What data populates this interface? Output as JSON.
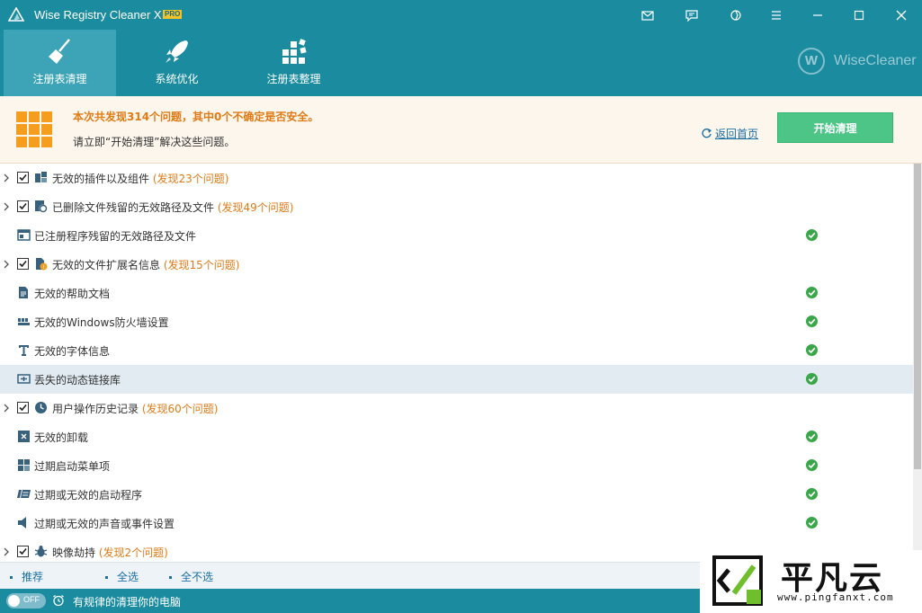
{
  "app": {
    "title": "Wise Registry Cleaner X",
    "badge": "PRO"
  },
  "window_controls": [
    {
      "name": "mail-icon"
    },
    {
      "name": "feedback-icon"
    },
    {
      "name": "skin-icon"
    },
    {
      "name": "menu-icon"
    },
    {
      "name": "minimize-icon"
    },
    {
      "name": "maximize-icon"
    },
    {
      "name": "close-icon"
    }
  ],
  "tabs": [
    {
      "label": "注册表清理",
      "icon": "broom-icon",
      "active": true
    },
    {
      "label": "系统优化",
      "icon": "rocket-icon",
      "active": false
    },
    {
      "label": "注册表整理",
      "icon": "blocks-icon",
      "active": false
    }
  ],
  "brand": {
    "letter": "W",
    "text": "WiseCleaner"
  },
  "banner": {
    "headline": "本次共发现314个问题，其中0个不确定是否安全。",
    "sub": "请立即“开始清理”解决这些问题。",
    "back_link": "返回首页",
    "start_button": "开始清理"
  },
  "items": [
    {
      "label": "无效的插件以及组件",
      "count": "(发现23个问题)",
      "expandable": true,
      "checked": true,
      "ok": false,
      "icon": "plugin-icon",
      "highlighted": false
    },
    {
      "label": "已删除文件残留的无效路径及文件",
      "count": "(发现49个问题)",
      "expandable": true,
      "checked": true,
      "ok": false,
      "icon": "deleted-file-icon",
      "highlighted": false
    },
    {
      "label": "已注册程序残留的无效路径及文件",
      "count": "",
      "expandable": false,
      "checked": false,
      "ok": true,
      "icon": "program-window-icon",
      "highlighted": false
    },
    {
      "label": "无效的文件扩展名信息",
      "count": "(发现15个问题)",
      "expandable": true,
      "checked": true,
      "ok": false,
      "icon": "file-extension-icon",
      "highlighted": false
    },
    {
      "label": "无效的帮助文档",
      "count": "",
      "expandable": false,
      "checked": false,
      "ok": true,
      "icon": "help-document-icon",
      "highlighted": false
    },
    {
      "label": "无效的Windows防火墙设置",
      "count": "",
      "expandable": false,
      "checked": false,
      "ok": true,
      "icon": "firewall-icon",
      "highlighted": false
    },
    {
      "label": "无效的字体信息",
      "count": "",
      "expandable": false,
      "checked": false,
      "ok": true,
      "icon": "font-icon",
      "highlighted": false
    },
    {
      "label": "丢失的动态链接库",
      "count": "",
      "expandable": false,
      "checked": false,
      "ok": true,
      "icon": "dll-icon",
      "highlighted": true
    },
    {
      "label": "用户操作历史记录",
      "count": "(发现60个问题)",
      "expandable": true,
      "checked": true,
      "ok": false,
      "icon": "history-clock-icon",
      "highlighted": false
    },
    {
      "label": "无效的卸载",
      "count": "",
      "expandable": false,
      "checked": false,
      "ok": true,
      "icon": "uninstall-icon",
      "highlighted": false
    },
    {
      "label": "过期启动菜单项",
      "count": "",
      "expandable": false,
      "checked": false,
      "ok": true,
      "icon": "start-menu-icon",
      "highlighted": false
    },
    {
      "label": "过期或无效的启动程序",
      "count": "",
      "expandable": false,
      "checked": false,
      "ok": true,
      "icon": "startup-program-icon",
      "highlighted": false
    },
    {
      "label": "过期或无效的声音或事件设置",
      "count": "",
      "expandable": false,
      "checked": false,
      "ok": true,
      "icon": "sound-icon",
      "highlighted": false
    },
    {
      "label": "映像劫持",
      "count": "(发现2个问题)",
      "expandable": true,
      "checked": true,
      "ok": false,
      "icon": "bug-icon",
      "highlighted": false
    }
  ],
  "selection_links": [
    "推荐",
    "全选",
    "全不选"
  ],
  "status": {
    "toggle_text": "OFF",
    "schedule_text": "有规律的清理你的电脑"
  },
  "watermark": {
    "name": "平凡云",
    "url": "www.pingfanxt.com"
  },
  "colors": {
    "accent": "#1b8ba0",
    "warning": "#e07b16",
    "start_button": "#4cc586",
    "link": "#1a6fa3",
    "ok": "#3aa64a"
  }
}
